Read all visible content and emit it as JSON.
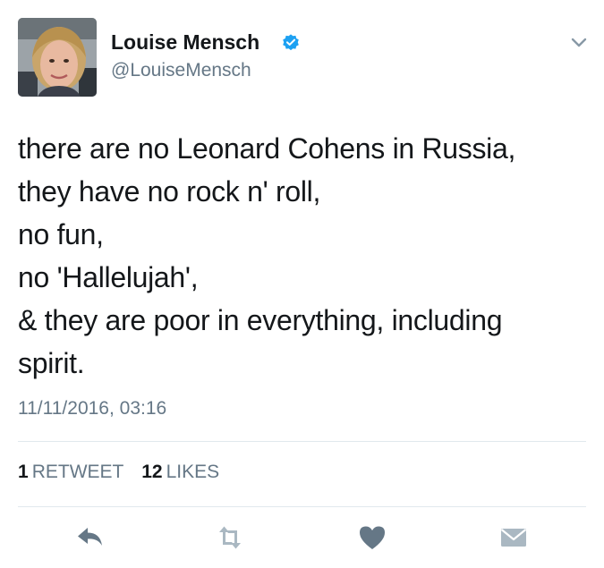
{
  "author": {
    "display_name": "Louise Mensch",
    "handle": "@LouiseMensch"
  },
  "tweet": {
    "lines": [
      "there are no Leonard Cohens in Russia,",
      "they have no rock n' roll,",
      "no fun,",
      "no 'Hallelujah',",
      "& they are poor in everything, including",
      "spirit."
    ],
    "timestamp": "11/11/2016, 03:16"
  },
  "stats": {
    "retweets": {
      "count": "1",
      "label": "RETWEET"
    },
    "likes": {
      "count": "12",
      "label": "LIKES"
    }
  },
  "icons": {
    "verified": "verified-badge-icon",
    "menu": "chevron-down-icon",
    "reply": "reply-icon",
    "retweet": "retweet-icon",
    "like": "heart-icon",
    "message": "envelope-icon"
  },
  "colors": {
    "text": "#14171a",
    "secondary": "#657786",
    "verified": "#1da1f2",
    "action_icon": "#657786",
    "inactive_icon": "#aab8c2",
    "divider": "#e1e8ed"
  }
}
